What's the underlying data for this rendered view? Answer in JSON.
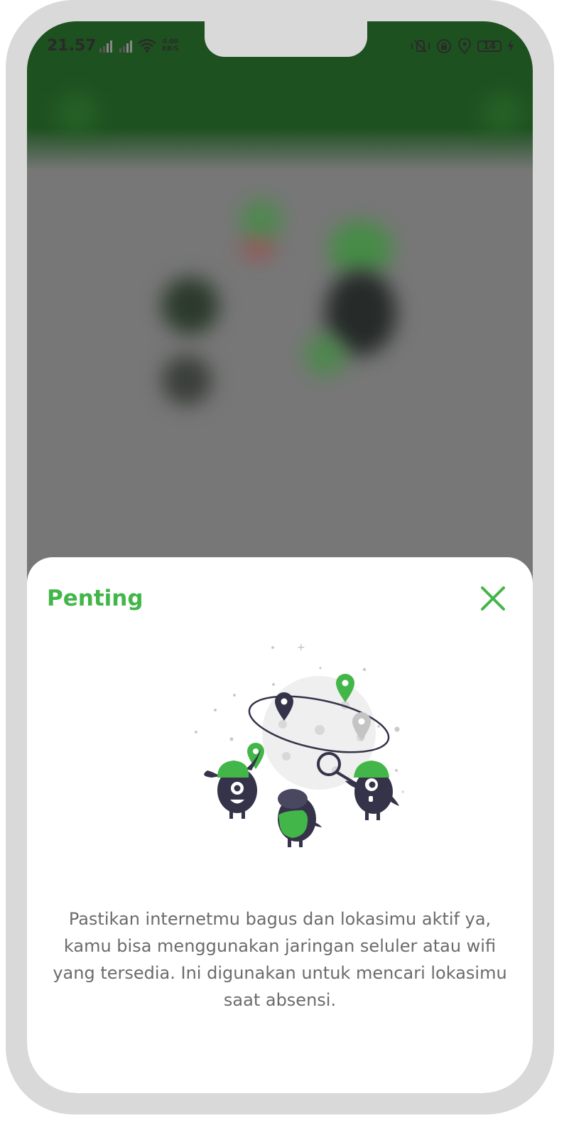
{
  "status_bar": {
    "time": "21.57",
    "net_speed_value": "0.00",
    "net_speed_unit": "KB/S",
    "battery_level": "14"
  },
  "icons": [
    "signal-icon",
    "wifi-icon",
    "vibrate-icon",
    "rotation-lock-icon",
    "location-icon",
    "battery-icon",
    "charging-icon",
    "close-icon"
  ],
  "dialog": {
    "title": "Penting",
    "message": "Pastikan internetmu bagus dan lokasimu aktif ya, kamu bisa menggunakan jaringan seluler atau wifi yang tersedia. Ini digunakan untuk mencari lokasimu saat absensi."
  },
  "colors": {
    "brand_green": "#43b649",
    "header_green": "#1e5120",
    "overlay_gray": "#777777",
    "text_gray": "#6b6b6b",
    "character_dark": "#35334a"
  }
}
